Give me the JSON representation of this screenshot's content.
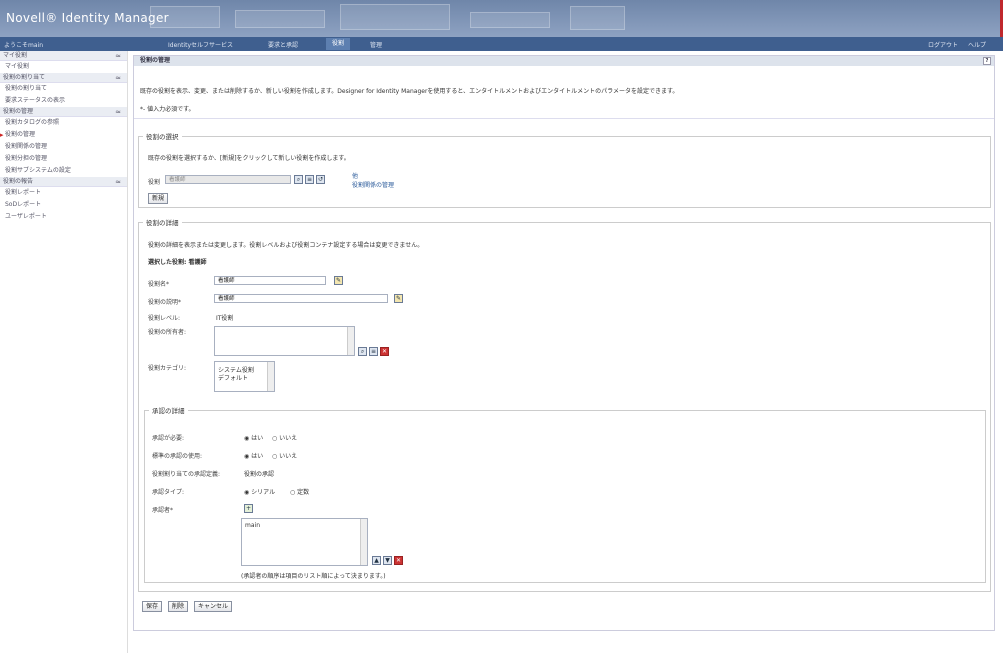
{
  "banner": {
    "title": "Novell® Identity Manager"
  },
  "nav": {
    "welcome": "ようこそmain",
    "tabs": [
      "Identityセルフサービス",
      "要求と承認",
      "役割",
      "管理"
    ],
    "active_tab": "役割",
    "right": [
      "ログアウト",
      "ヘルプ"
    ]
  },
  "sidebar": {
    "groups": [
      {
        "label": "マイ役割",
        "items": [
          "マイ役割"
        ]
      },
      {
        "label": "役割の割り当て",
        "items": [
          "役割の割り当て",
          "要求ステータスの表示"
        ]
      },
      {
        "label": "役割の管理",
        "items": [
          "役割カタログの参照",
          "役割の管理",
          "役割関係の管理",
          "役割分担の管理",
          "役割サブシステムの設定"
        ]
      },
      {
        "label": "役割の報告",
        "items": [
          "役割レポート",
          "SoDレポート",
          "ユーザレポート"
        ]
      }
    ],
    "current_item": "役割の管理",
    "collapse_glyph": "≈"
  },
  "main": {
    "header": "役割の管理",
    "help_glyph": "?",
    "description": "既存の役割を表示、変更、または削除するか、新しい役割を作成します。Designer for Identity Managerを使用すると、エンタイトルメントおよびエンタイトルメントのパラメータを設定できます。",
    "required_note": "*- 値入力必須です。",
    "select_section": {
      "legend": "役割の選択",
      "help": "既存の役割を選択するか、[新規]をクリックして新しい役割を作成します。",
      "role_label": "役割",
      "role_value": "看護師",
      "link_prefix": "他",
      "link_manage": "役割関係の管理",
      "new_button": "新規"
    },
    "detail_section": {
      "legend": "役割の詳細",
      "help": "役割の詳細を表示または変更します。役割レベルおよび役割コンテナ設定する場合は変更できません。",
      "selected_label": "選択した役割: 看護師",
      "name_label": "役割名*",
      "name_value": "看護師",
      "desc_label": "役割の説明*",
      "desc_value": "看護師",
      "level_label": "役割レベル:",
      "level_value": "IT役割",
      "owner_label": "役割の所有者:",
      "category_label": "役割カテゴリ:",
      "categories": [
        "システム役割",
        "デフォルト"
      ]
    },
    "approval_section": {
      "legend": "承認の詳細",
      "required_label": "承認が必要:",
      "required_options": [
        "はい",
        "いいえ"
      ],
      "standard_label": "標準の承認の使用:",
      "standard_options": [
        "はい",
        "いいえ"
      ],
      "def_label": "役割割り当ての承認定義:",
      "def_value": "役割の承認",
      "type_label": "承認タイプ:",
      "type_options": [
        "シリアル",
        "定数"
      ],
      "approver_label": "承認者*",
      "approvers": [
        "main"
      ],
      "note": "(承認者の順序は項目のリスト順によって決まります。)"
    },
    "buttons": {
      "save": "保存",
      "delete": "削除",
      "cancel": "キャンセル"
    }
  }
}
